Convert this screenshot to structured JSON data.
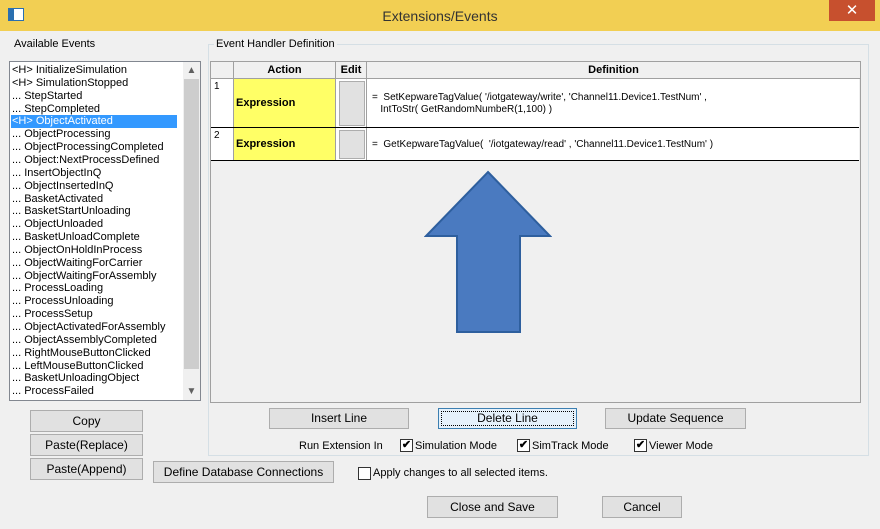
{
  "window": {
    "title": "Extensions/Events",
    "close_glyph": "✕",
    "icon": "window-icon"
  },
  "events_panel": {
    "label": "Available Events",
    "items": [
      "<H> InitializeSimulation",
      "<H> SimulationStopped",
      "... StepStarted",
      "... StepCompleted",
      "<H> ObjectActivated",
      "... ObjectProcessing",
      "... ObjectProcessingCompleted",
      "... Object:NextProcessDefined",
      "... InsertObjectInQ",
      "... ObjectInsertedInQ",
      "... BasketActivated",
      "... BasketStartUnloading",
      "... ObjectUnloaded",
      "... BasketUnloadComplete",
      "... ObjectOnHoldInProcess",
      "... ObjectWaitingForCarrier",
      "... ObjectWaitingForAssembly",
      "... ProcessLoading",
      "... ProcessUnloading",
      "... ProcessSetup",
      "... ObjectActivatedForAssembly",
      "... ObjectAssemblyCompleted",
      "... RightMouseButtonClicked",
      "... LeftMouseButtonClicked",
      "... BasketUnloadingObject",
      "... ProcessFailed"
    ],
    "selected_index": 4
  },
  "handler": {
    "label": "Event Handler Definition",
    "columns": [
      "Action",
      "Edit",
      "Definition"
    ],
    "rows": [
      {
        "num": "1",
        "action": "Expression",
        "def_line1": "=  SetKepwareTagValue( '/iotgateway/write', 'Channel11.Device1.TestNum' ,",
        "def_line2": "   IntToStr( GetRandomNumbeR(1,100) )"
      },
      {
        "num": "2",
        "action": "Expression",
        "def_line1": "=  GetKepwareTagValue(  '/iotgateway/read' , 'Channel11.Device1.TestNum' )"
      }
    ]
  },
  "left_buttons": {
    "copy": "Copy",
    "paste_replace": "Paste(Replace)",
    "paste_append": "Paste(Append)"
  },
  "line_buttons": {
    "insert": "Insert Line",
    "delete": "Delete Line",
    "update": "Update Sequence"
  },
  "run_ext": {
    "label": "Run Extension In",
    "simulation": {
      "label": "Simulation Mode",
      "checked": true
    },
    "simtrack": {
      "label": "SimTrack Mode",
      "checked": true
    },
    "viewer": {
      "label": "Viewer Mode",
      "checked": true
    }
  },
  "db_button": "Define Database Connections",
  "apply_all": {
    "label": "Apply changes to all selected items.",
    "checked": false
  },
  "footer": {
    "close_save": "Close and Save",
    "cancel": "Cancel"
  },
  "check_glyph": "✔",
  "scroll_up_glyph": "▲",
  "scroll_down_glyph": "▼",
  "colors": {
    "titlebar": "#f2cf53",
    "close": "#c7502e",
    "arrow_fill": "#4a7ac0",
    "arrow_stroke": "#2e5f9e",
    "action_cell": "#ffff66",
    "selection": "#3399ff"
  }
}
